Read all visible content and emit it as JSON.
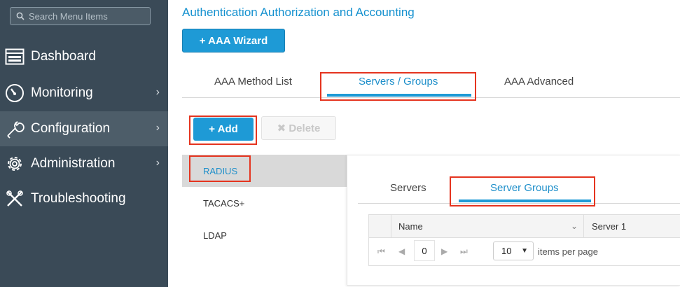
{
  "search": {
    "placeholder": "Search Menu Items"
  },
  "sidebar": {
    "items": [
      {
        "label": "Dashboard",
        "icon": "dashboard-icon",
        "has_chevron": false
      },
      {
        "label": "Monitoring",
        "icon": "gauge-icon",
        "has_chevron": true
      },
      {
        "label": "Configuration",
        "icon": "wrench-icon",
        "has_chevron": true,
        "active": true
      },
      {
        "label": "Administration",
        "icon": "gear-icon",
        "has_chevron": true
      },
      {
        "label": "Troubleshooting",
        "icon": "tools-icon",
        "has_chevron": false
      }
    ],
    "chevron": "›"
  },
  "page": {
    "title": "Authentication Authorization and Accounting"
  },
  "wizard_button": {
    "label": "+ AAA Wizard"
  },
  "tabs": [
    {
      "label": "AAA Method List"
    },
    {
      "label": "Servers / Groups",
      "active": true
    },
    {
      "label": "AAA Advanced"
    }
  ],
  "toolbar": {
    "add_label": "+ Add",
    "delete_label": "✖ Delete"
  },
  "server_types": [
    {
      "label": "RADIUS",
      "active": true
    },
    {
      "label": "TACACS+"
    },
    {
      "label": "LDAP"
    }
  ],
  "subtabs": [
    {
      "label": "Servers"
    },
    {
      "label": "Server Groups",
      "active": true
    }
  ],
  "grid": {
    "columns": [
      "Name",
      "Server 1"
    ],
    "pager": {
      "page": "0",
      "per_page": "10",
      "per_page_label": "items per page"
    }
  },
  "colors": {
    "accent": "#1e9ad6",
    "sidebar_bg": "#3a4a57",
    "highlight_box": "#e5341f"
  }
}
